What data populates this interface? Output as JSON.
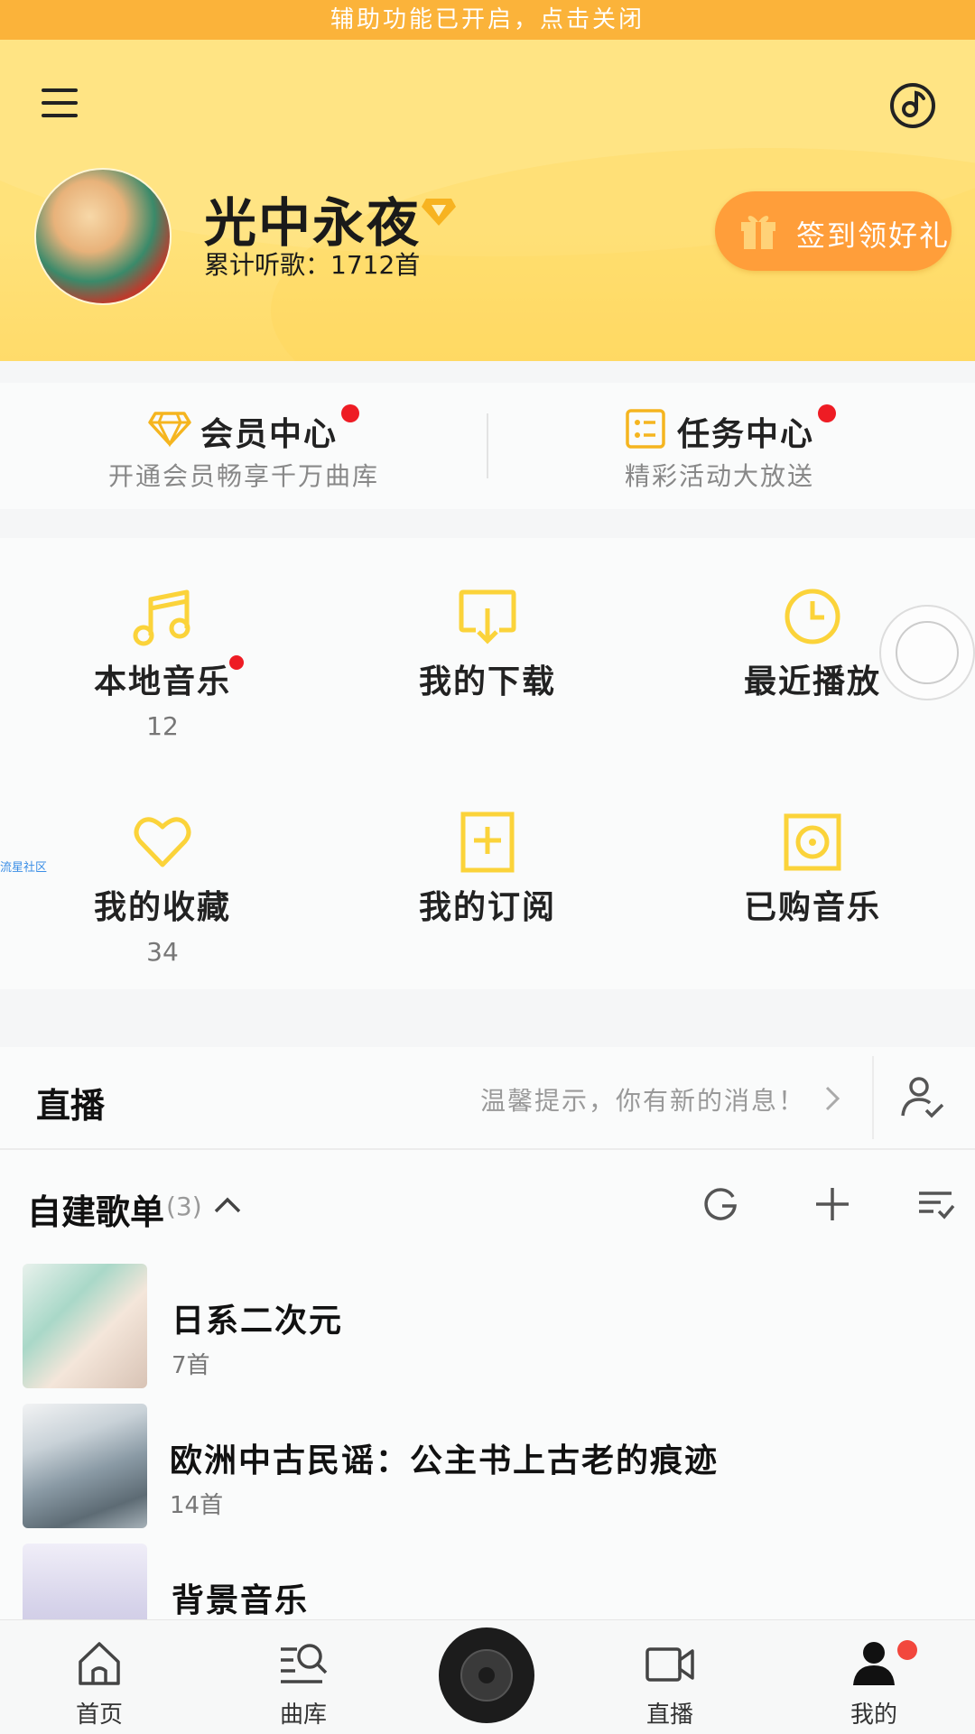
{
  "banner": {
    "text": "辅助功能已开启，点击关闭"
  },
  "header": {
    "username": "光中永夜",
    "listen_count": "累计听歌：1712首",
    "signin_label": "签到领好礼",
    "accent": "#ffe27a",
    "signin_color": "#ff9e3a"
  },
  "member": {
    "title": "会员中心",
    "subtitle": "开通会员畅享千万曲库"
  },
  "task": {
    "title": "任务中心",
    "subtitle": "精彩活动大放送"
  },
  "grid": {
    "items": [
      {
        "label": "本地音乐",
        "count": "12",
        "icon": "music-note-icon"
      },
      {
        "label": "我的下载",
        "count": "",
        "icon": "download-icon"
      },
      {
        "label": "最近播放",
        "count": "",
        "icon": "clock-icon"
      },
      {
        "label": "我的收藏",
        "count": "34",
        "icon": "heart-icon"
      },
      {
        "label": "我的订阅",
        "count": "",
        "icon": "subscribe-icon"
      },
      {
        "label": "已购音乐",
        "count": "",
        "icon": "purchased-music-icon"
      }
    ],
    "icon_color": "#fbd33a"
  },
  "side_tag": "流星社区",
  "live": {
    "title": "直播",
    "tip": "温馨提示，你有新的消息！"
  },
  "playlists": {
    "title": "自建歌单",
    "count": "(3)",
    "items": [
      {
        "name": "日系二次元",
        "count": "7首"
      },
      {
        "name": "欧洲中古民谣：公主书上古老的痕迹",
        "count": "14首"
      },
      {
        "name": "背景音乐",
        "count": ""
      }
    ]
  },
  "nav": {
    "items": [
      {
        "label": "首页",
        "icon": "home-icon"
      },
      {
        "label": "曲库",
        "icon": "library-search-icon"
      },
      {
        "label": "直播",
        "icon": "video-camera-icon"
      },
      {
        "label": "我的",
        "icon": "profile-icon"
      }
    ]
  }
}
